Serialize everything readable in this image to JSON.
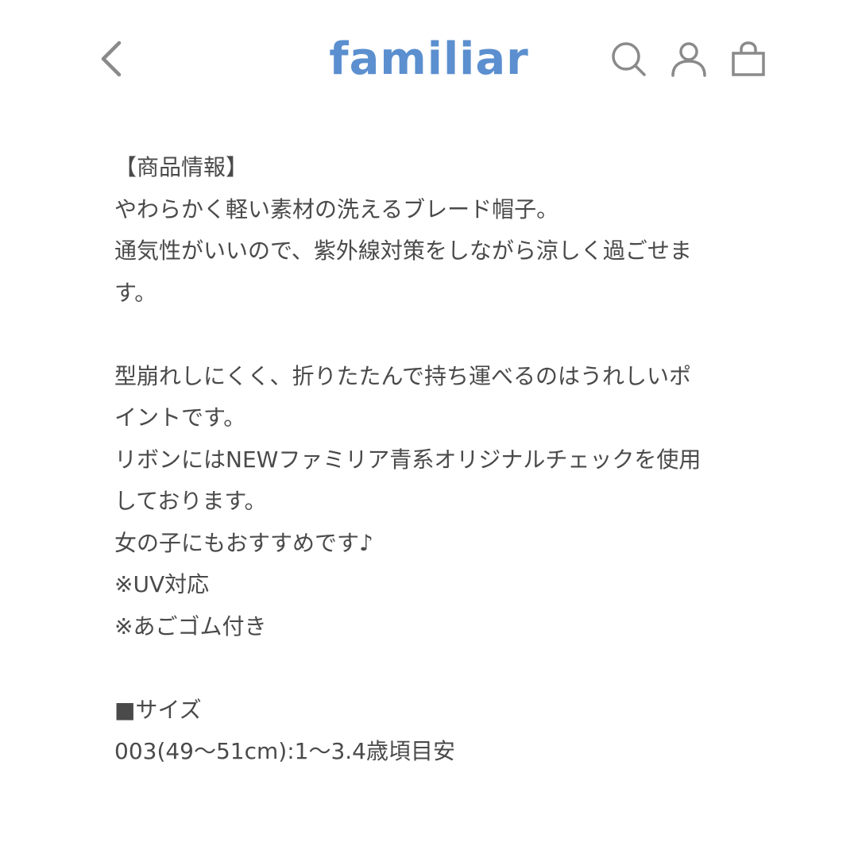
{
  "header": {
    "logo_text": "familiar",
    "icons": [
      "chevron-left-icon",
      "search-icon",
      "user-icon",
      "bag-icon"
    ],
    "accent_color": "#5b8fcf"
  },
  "description": {
    "lines": [
      "【商品情報】",
      "やわらかく軽い素材の洗えるブレード帽子。",
      "通気性がいいので、紫外線対策をしながら涼しく過ごせま",
      "す。",
      "",
      "型崩れしにくく、折りたたんで持ち運べるのはうれしいポ",
      "イントです。",
      "リボンにはNEWファミリア青系オリジナルチェックを使用",
      "しております。",
      "女の子にもおすすめです♪",
      "※UV対応",
      "※あごゴム付き",
      "",
      "■サイズ",
      "003(49〜51cm):1〜3.4歳頃目安"
    ]
  }
}
